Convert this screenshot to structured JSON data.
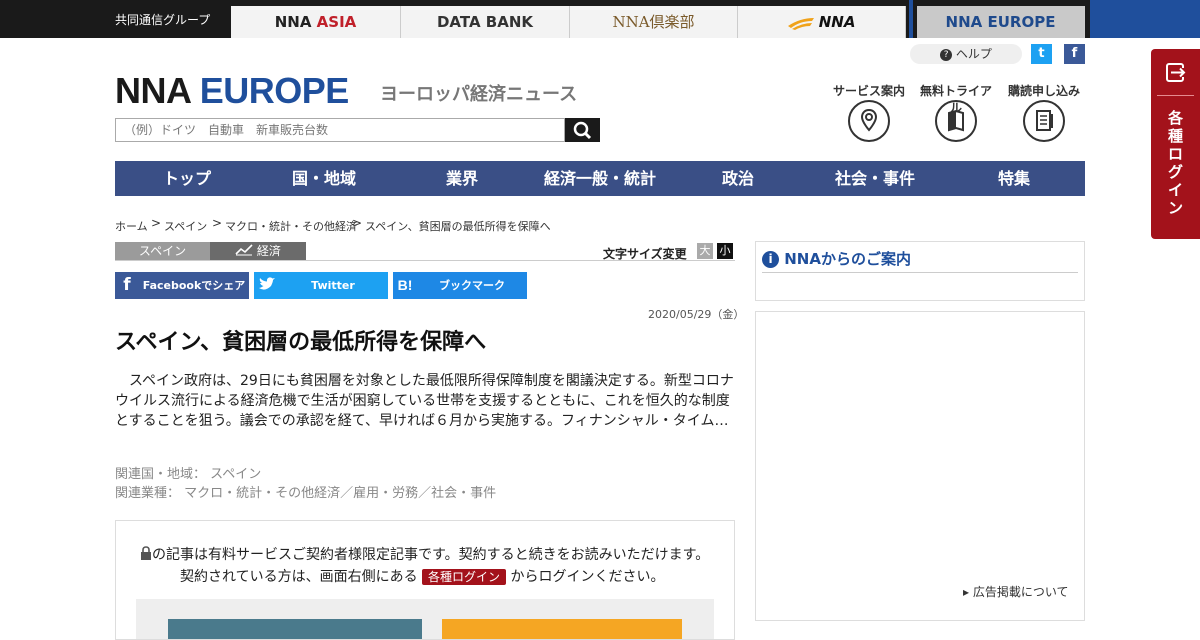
{
  "top_bar": {
    "group_label": "共同通信グループ",
    "tabs": [
      "NNA ASIA",
      "DATA BANK",
      "NNA倶楽部",
      "NNA",
      "NNA EUROPE"
    ]
  },
  "util": {
    "help_label": "ヘルプ",
    "twitter_glyph": "t",
    "facebook_glyph": "f"
  },
  "logo": {
    "part1": "NNA",
    "part2": "EUROPE",
    "tagline": "ヨーロッパ経済ニュース"
  },
  "search": {
    "placeholder": "（例）ドイツ　自動車　新車販売台数"
  },
  "services": [
    "サービス案内",
    "無料トライアル",
    "購読申し込み"
  ],
  "nav": [
    "トップ",
    "国・地域",
    "業界",
    "経済一般・統計",
    "政治",
    "社会・事件",
    "特集"
  ],
  "breadcrumb": [
    "ホーム",
    "スペイン",
    "マクロ・統計・その他経済",
    "スペイン、貧困層の最低所得を保障へ"
  ],
  "category_tabs": [
    "スペイン",
    "経済"
  ],
  "font_size": {
    "label": "文字サイズ変更",
    "large": "大",
    "small": "小"
  },
  "share": {
    "facebook": "Facebookでシェア",
    "twitter": "Twitter",
    "hatena": "ブックマーク",
    "hatena_icon": "B!"
  },
  "article": {
    "date": "2020/05/29（金）",
    "title": "スペイン、貧困層の最低所得を保障へ",
    "body": "　スペイン政府は、29日にも貧困層を対象とした最低限所得保障制度を閣議決定する。新型コロナウイルス流行による経済危機で生活が困窮している世帯を支援するとともに、これを恒久的な制度とすることを狙う。議会での承認を経て、早ければ６月から実施する。フィナンシャル・タイム…",
    "related_region": "関連国・地域： スペイン",
    "related_industry": "関連業種： マクロ・統計・その他経済／雇用・労務／社会・事件"
  },
  "paywall": {
    "line1": "の記事は有料サービスご契約者様限定記事です。契約すると続きをお読みいただけます。",
    "line2_pre": "契約されている方は、画面右側にある",
    "login_btn": "各種ログイン",
    "line2_post": "からログインください。"
  },
  "sidebar": {
    "heading": "NNAからのご案内",
    "ad_link": "▸ 広告掲載について"
  },
  "login_tab": {
    "label": "各種ログイン"
  },
  "colors": {
    "brand_blue": "#1f4f9c",
    "nav_bg": "#3a4f86",
    "login_red": "#a3121b"
  }
}
